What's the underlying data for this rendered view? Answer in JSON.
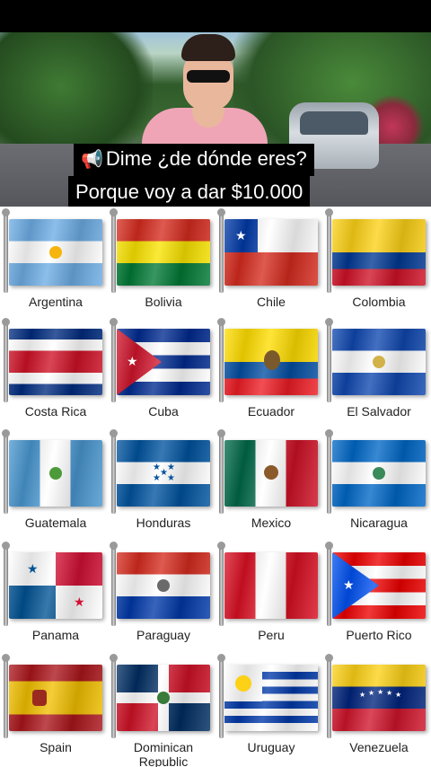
{
  "caption": {
    "line1": "Dime ¿de dónde eres?",
    "line2": "Porque voy a dar $10.000",
    "icon": "megaphone-icon"
  },
  "flags": [
    {
      "label": "Argentina",
      "key": "argentina"
    },
    {
      "label": "Bolivia",
      "key": "bolivia"
    },
    {
      "label": "Chile",
      "key": "chile"
    },
    {
      "label": "Colombia",
      "key": "colombia"
    },
    {
      "label": "Costa Rica",
      "key": "costarica"
    },
    {
      "label": "Cuba",
      "key": "cuba"
    },
    {
      "label": "Ecuador",
      "key": "ecuador"
    },
    {
      "label": "El Salvador",
      "key": "elsalvador"
    },
    {
      "label": "Guatemala",
      "key": "guatemala"
    },
    {
      "label": "Honduras",
      "key": "honduras"
    },
    {
      "label": "Mexico",
      "key": "mexico"
    },
    {
      "label": "Nicaragua",
      "key": "nicaragua"
    },
    {
      "label": "Panama",
      "key": "panama"
    },
    {
      "label": "Paraguay",
      "key": "paraguay"
    },
    {
      "label": "Peru",
      "key": "peru"
    },
    {
      "label": "Puerto Rico",
      "key": "puertorico"
    },
    {
      "label": "Spain",
      "key": "spain"
    },
    {
      "label": "Dominican Republic",
      "key": "dominican"
    },
    {
      "label": "Uruguay",
      "key": "uruguay"
    },
    {
      "label": "Venezuela",
      "key": "venezuela"
    }
  ]
}
